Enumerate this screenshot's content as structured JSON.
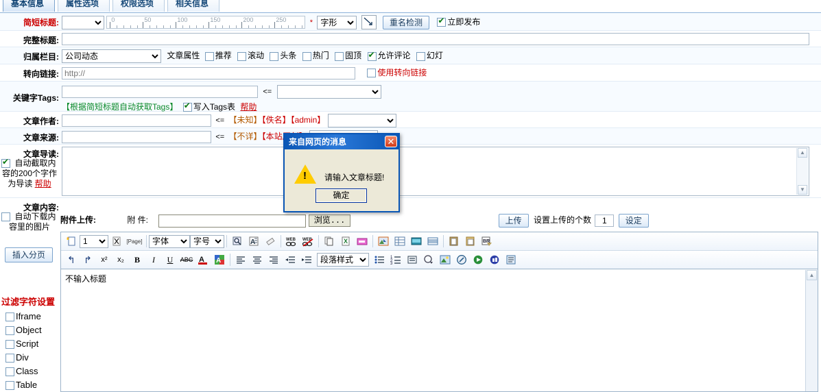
{
  "tabs": [
    {
      "label": "基本信息",
      "active": true
    },
    {
      "label": "属性选项",
      "active": false
    },
    {
      "label": "权限选项",
      "active": false
    },
    {
      "label": "相关信息",
      "active": false
    }
  ],
  "form": {
    "short_title": {
      "label": "简短标题:",
      "select_value": "",
      "required_mark": "*",
      "ruler_ticks": [
        "0",
        "50",
        "100",
        "150",
        "200",
        "250"
      ],
      "font_style_select": "字形",
      "dup_check_button": "重名检测",
      "publish_now": {
        "label": "立即发布",
        "checked": true
      }
    },
    "full_title": {
      "label": "完整标题:",
      "value": ""
    },
    "category": {
      "label": "归属栏目:",
      "value": "公司动态",
      "attr_label": "文章属性",
      "attrs": [
        {
          "label": "推荐",
          "checked": false
        },
        {
          "label": "滚动",
          "checked": false
        },
        {
          "label": "头条",
          "checked": false
        },
        {
          "label": "热门",
          "checked": false
        },
        {
          "label": "固顶",
          "checked": false
        },
        {
          "label": "允许评论",
          "checked": true
        },
        {
          "label": "幻灯",
          "checked": false
        }
      ]
    },
    "redirect": {
      "label": "转向链接:",
      "placeholder": "http://",
      "value": "",
      "use_label": "使用转向链接",
      "use_checked": false
    },
    "tags": {
      "label": "关键字Tags:",
      "value": "",
      "arrow": "<=",
      "select_value": "",
      "auto_hint": "【根据简短标题自动获取Tags】",
      "write_label": "写入Tags表",
      "write_checked": true,
      "help": "帮助"
    },
    "author": {
      "label": "文章作者:",
      "value": "",
      "arrow": "<=",
      "presets": [
        "【未知】",
        "【佚名】",
        "【admin】"
      ],
      "select_value": ""
    },
    "source": {
      "label": "文章来源:",
      "value": "",
      "arrow": "<=",
      "presets": [
        "【不详】",
        "【本站原创】"
      ],
      "select_value": ""
    },
    "intro": {
      "label": "文章导读:",
      "auto_checked": true,
      "auto_text": "自动截取内容的200个字作为导读",
      "help": "帮助",
      "value": ""
    },
    "content": {
      "label": "文章内容:",
      "auto_img_checked": false,
      "auto_img_text": "自动下载内容里的图片",
      "insert_page_button": "插入分页"
    }
  },
  "attachment": {
    "section_label": "附件上传:",
    "field_label": "附 件:",
    "value": "",
    "browse_button": "浏览...",
    "upload_button": "上传",
    "count_label": "设置上传的个数",
    "count_value": "1",
    "set_button": "设定"
  },
  "filter_panel": {
    "title": "过滤字符设置",
    "items": [
      {
        "label": "Iframe",
        "checked": false
      },
      {
        "label": "Object",
        "checked": false
      },
      {
        "label": "Script",
        "checked": false
      },
      {
        "label": "Div",
        "checked": false
      },
      {
        "label": "Class",
        "checked": false
      },
      {
        "label": "Table",
        "checked": false
      }
    ]
  },
  "editor": {
    "page_num_value": "1",
    "page_tag": "[Page]",
    "font_select": "字体",
    "size_select": "字号",
    "para_select": "段落样式",
    "toolbar_row1": [
      "new-document-icon",
      "page-number-select",
      "delete-page-icon",
      "page-tag-icon",
      "font-family-select",
      "font-size-select",
      "preview-icon",
      "text-effect-icon",
      "eraser-icon",
      "insert-link-icon",
      "remove-link-icon",
      "copy-icon",
      "excel-import-icon",
      "word-import-icon",
      "insert-image-icon",
      "insert-table-icon",
      "insert-media-icon",
      "insert-grid-icon",
      "paste-icon",
      "paste-plain-icon",
      "paste-word-icon"
    ],
    "toolbar_row2": [
      "undo-icon",
      "redo-icon",
      "superscript-icon",
      "subscript-icon",
      "bold-icon",
      "italic-icon",
      "underline-icon",
      "strikethrough-icon",
      "font-color-icon",
      "highlight-color-icon",
      "align-left-icon",
      "align-center-icon",
      "align-right-icon",
      "outdent-icon",
      "indent-icon",
      "paragraph-style-select",
      "bullet-list-icon",
      "numbered-list-icon",
      "blockquote-icon",
      "emoticon-icon",
      "image-gallery-icon",
      "flash-icon",
      "media-player-icon",
      "sound-icon",
      "source-code-icon"
    ],
    "body_text": "不输入标题"
  },
  "dialog": {
    "title": "来自网页的消息",
    "close_label": "✕",
    "message": "请输入文章标题!",
    "ok_button": "确定"
  },
  "colors": {
    "accent": "#0a56b5",
    "required": "#cc0000",
    "link": "#cc0000",
    "green": "#0a8a2a"
  }
}
